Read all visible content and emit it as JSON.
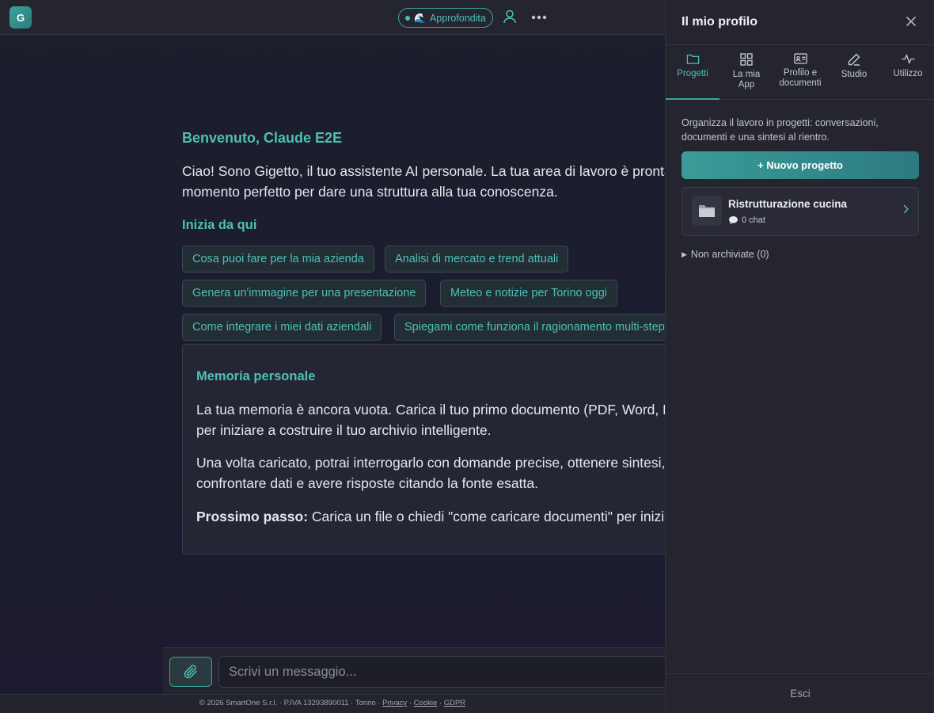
{
  "app": {
    "logo_letter": "G",
    "accent": "#4dc0b5"
  },
  "topbar": {
    "mode_label": "Approfondita",
    "mode_icon": "wave-emoji",
    "user_icon": "user-icon",
    "more_icon": "more-dots-icon"
  },
  "main": {
    "welcome_title": "Benvenuto, Claude E2E",
    "welcome_text": "Ciao! Sono Gigetto, il tuo assistente AI personale. La tua area di lavoro è pronta: è il momento perfetto per dare una struttura alla tua conoscenza.",
    "start_title": "Inizia da qui",
    "suggestions": [
      "Cosa puoi fare per la mia azienda",
      "Analisi di mercato e trend attuali",
      "Genera un'immagine per una presentazione",
      "Meteo e notizie per Torino oggi",
      "Come integrare i miei dati aziendali",
      "Spiegami come funziona il ragionamento multi-step"
    ],
    "memory": {
      "title": "Memoria personale",
      "p1": "La tua memoria è ancora vuota. Carica il tuo primo documento (PDF, Word, Excel...) per iniziare a costruire il tuo archivio intelligente.",
      "p2": "Una volta caricato, potrai interrogarlo con domande precise, ottenere sintesi, confrontare dati e avere risposte citando la fonte esatta.",
      "next_label": "Prossimo passo:",
      "next_text": " Carica un file o chiedi \"come caricare documenti\" per iniziare."
    }
  },
  "composer": {
    "attach_icon": "paperclip-icon",
    "placeholder": "Scrivi un messaggio..."
  },
  "footer": {
    "text": "© 2026 SmartOne S.r.l. · P.IVA 13293890011 · Torino · ",
    "privacy": "Privacy",
    "sep": " · ",
    "cookie": "Cookie",
    "gdpr": "GDPR"
  },
  "panel": {
    "title": "Il mio profilo",
    "close_icon": "close-icon",
    "tabs": [
      {
        "label": "Progetti",
        "icon": "folder-icon",
        "active": true
      },
      {
        "label": "La mia App",
        "icon": "grid-icon",
        "active": false
      },
      {
        "label": "Profilo e documenti",
        "icon": "id-card-icon",
        "active": false
      },
      {
        "label": "Studio",
        "icon": "pen-icon",
        "active": false
      },
      {
        "label": "Utilizzo",
        "icon": "activity-icon",
        "active": false
      }
    ],
    "intro": "Organizza il lavoro in progetti: conversazioni, documenti e una sintesi al rientro.",
    "new_project_label": "+ Nuovo progetto",
    "projects": [
      {
        "name": "Ristrutturazione cucina",
        "chats": "0 chat",
        "icon": "folder-emoji"
      }
    ],
    "archive_label": "Non archiviate (0)",
    "logout_label": "Esci"
  }
}
